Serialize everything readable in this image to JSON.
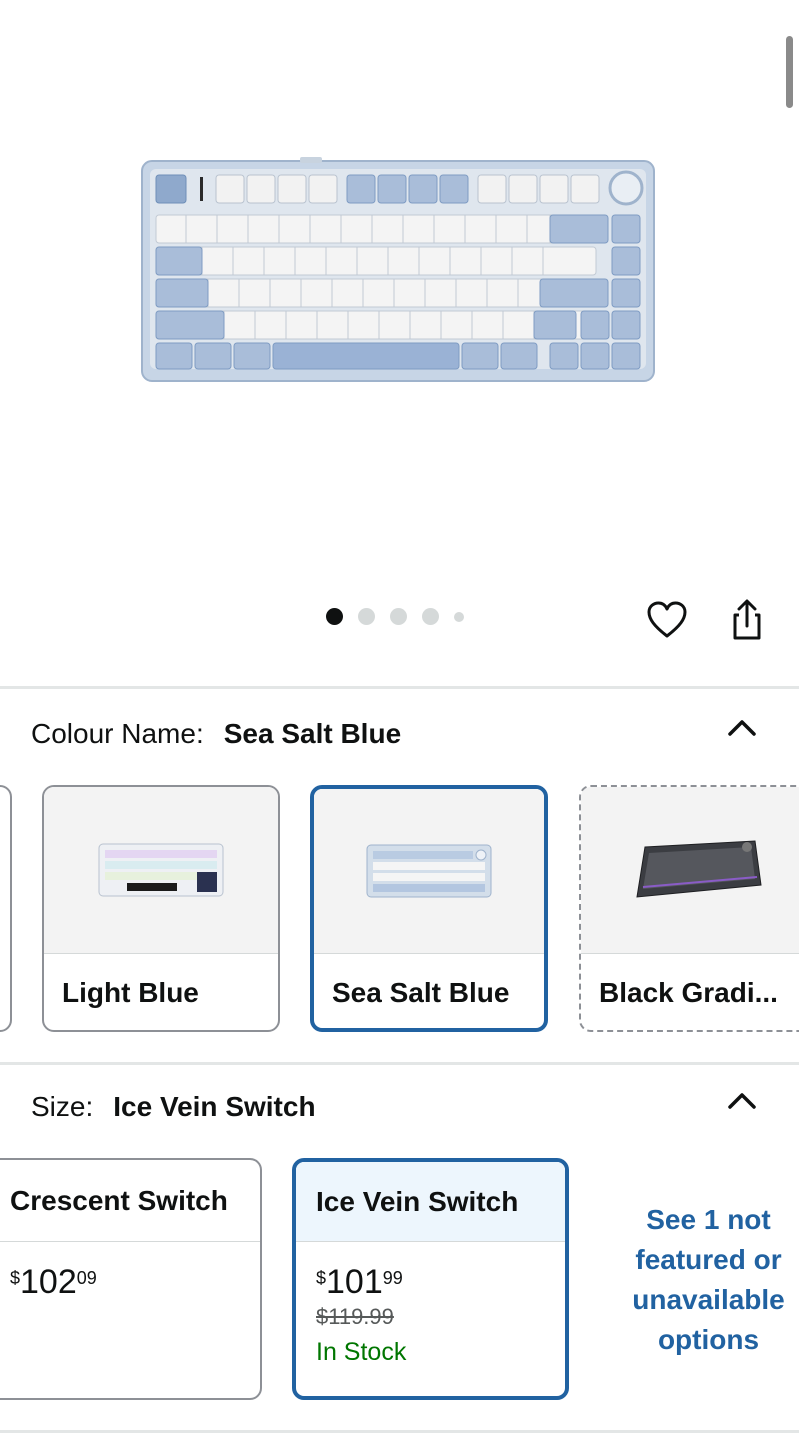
{
  "carousel": {
    "page_count": 5,
    "active_index": 0
  },
  "colour": {
    "label": "Colour Name:",
    "selected": "Sea Salt Blue",
    "options": [
      {
        "name": "Light Blue"
      },
      {
        "name": "Sea Salt Blue"
      },
      {
        "name": "Black Gradi..."
      }
    ]
  },
  "size": {
    "label": "Size:",
    "selected": "Ice Vein Switch",
    "options": [
      {
        "name": "Crescent Switch",
        "price_symbol": "$",
        "price_whole": "102",
        "price_fraction": "09"
      },
      {
        "name": "Ice Vein Switch",
        "price_symbol": "$",
        "price_whole": "101",
        "price_fraction": "99",
        "list_price": "$119.99",
        "availability": "In Stock"
      }
    ],
    "see_more": "See 1 not featured or unavailable options"
  },
  "icons": {
    "wishlist": "heart-icon",
    "share": "share-icon",
    "collapse": "chevron-up-icon"
  },
  "colors": {
    "accent": "#2162a1",
    "in_stock": "#007600",
    "dot_active": "#0f1111",
    "dot_inactive": "#d5d9d9"
  }
}
